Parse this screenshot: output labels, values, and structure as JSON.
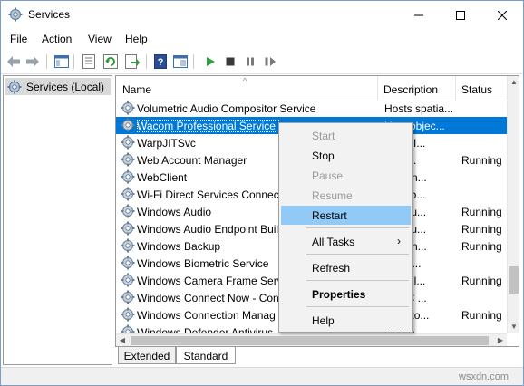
{
  "window": {
    "title": "Services"
  },
  "menu": [
    "File",
    "Action",
    "View",
    "Help"
  ],
  "toolbar": {
    "icons": [
      "back-arrow-icon",
      "forward-arrow-icon",
      "show-hide-tree-icon",
      "properties-icon",
      "refresh-icon",
      "export-list-icon",
      "help-icon",
      "console-icon",
      "start-service-icon",
      "stop-service-icon",
      "pause-service-icon",
      "restart-service-icon"
    ]
  },
  "tree": {
    "root_label": "Services (Local)"
  },
  "columns": {
    "name": "Name",
    "description": "Description",
    "status": "Status"
  },
  "services": [
    {
      "name": "Volumetric Audio Compositor Service",
      "description": "Hosts spatia...",
      "status": ""
    },
    {
      "name": "Wacom Professional Service",
      "description": "Host objec...",
      "status": ""
    },
    {
      "name": "WarpJITSvc",
      "description": "es a JI...",
      "status": ""
    },
    {
      "name": "Web Account Manager",
      "description": "web ...",
      "status": "Running"
    },
    {
      "name": "WebClient",
      "description": "es Win...",
      "status": ""
    },
    {
      "name": "Wi-Fi Direct Services Connecti",
      "description": "ges co...",
      "status": ""
    },
    {
      "name": "Windows Audio",
      "description": "ges au...",
      "status": "Running"
    },
    {
      "name": "Windows Audio Endpoint Buil",
      "description": "ges au...",
      "status": "Running"
    },
    {
      "name": "Windows Backup",
      "description": "es Win...",
      "status": "Running"
    },
    {
      "name": "Windows Biometric Service",
      "description": "Vindo...",
      "status": ""
    },
    {
      "name": "Windows Camera Frame Serv",
      "description": "es mul...",
      "status": "Running"
    },
    {
      "name": "Windows Connect Now - Con",
      "description": "CSVC ...",
      "status": ""
    },
    {
      "name": "Windows Connection Manag",
      "description": "es auto...",
      "status": "Running"
    },
    {
      "name": "Windows Defender Antivirus",
      "description": "ps pro...",
      "status": ""
    }
  ],
  "selected_index": 1,
  "context_menu": {
    "start": "Start",
    "stop": "Stop",
    "pause": "Pause",
    "resume": "Resume",
    "restart": "Restart",
    "all_tasks": "All Tasks",
    "refresh": "Refresh",
    "properties": "Properties",
    "help": "Help",
    "submenu_glyph": "›"
  },
  "tabs": {
    "extended": "Extended",
    "standard": "Standard"
  },
  "watermark": "wsxdn.com",
  "colors": {
    "selection": "#0078d7",
    "menu_highlight": "#91c9f7",
    "start_green": "#2ea043"
  }
}
